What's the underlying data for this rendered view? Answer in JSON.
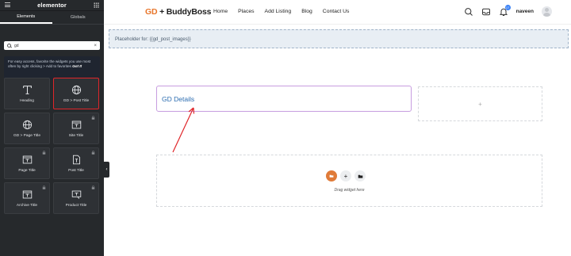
{
  "panel": {
    "title": "elementor",
    "tabs": [
      {
        "label": "Elements"
      },
      {
        "label": "Globals"
      }
    ],
    "search_value": "gd",
    "clear_symbol": "×",
    "tip_text": "For easy access, favorite the widgets you use most often by right clicking > Add to favorites",
    "tip_link": "Got It",
    "widgets": [
      {
        "label": "Heading"
      },
      {
        "label": "GD > Post Title"
      },
      {
        "label": "GD > Page Title"
      },
      {
        "label": "Site Title"
      },
      {
        "label": "Page Title"
      },
      {
        "label": "Post Title"
      },
      {
        "label": "Archive Title"
      },
      {
        "label": "Product Title"
      }
    ],
    "collapse_symbol": "‹"
  },
  "header": {
    "brand_gd": "GD",
    "brand_rest": " + BuddyBoss",
    "nav": [
      {
        "label": "Home"
      },
      {
        "label": "Places"
      },
      {
        "label": "Add Listing"
      },
      {
        "label": "Blog"
      },
      {
        "label": "Contact Us"
      }
    ],
    "notification_count": "17",
    "user_name": "naveen"
  },
  "canvas": {
    "placeholder_text": "Placeholder for: {{gd_post_images}}",
    "gd_details_text": "GD Details",
    "empty_column_symbol": "+",
    "drop_zone_text": "Drag widget here",
    "add_symbol": "+"
  },
  "colors": {
    "highlight": "#e0262a",
    "brand_accent": "#e8762b",
    "link_blue": "#2b6cb0",
    "selection_purple": "#c79de0"
  }
}
